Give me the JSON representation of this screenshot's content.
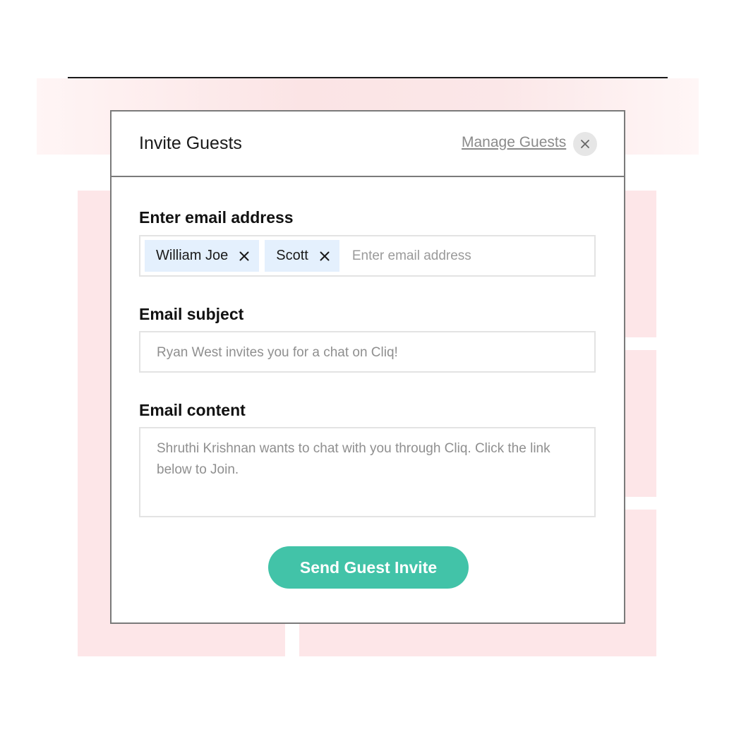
{
  "dialog": {
    "title": "Invite Guests",
    "manage_link": "Manage Guests",
    "close_icon": "close-icon"
  },
  "email_field": {
    "label": "Enter email address",
    "chips": [
      {
        "label": "William Joe",
        "remove_icon": "close-icon"
      },
      {
        "label": "Scott",
        "remove_icon": "close-icon"
      }
    ],
    "placeholder": "Enter email address"
  },
  "subject_field": {
    "label": "Email subject",
    "value": "Ryan West invites you for a chat on Cliq!"
  },
  "content_field": {
    "label": "Email content",
    "value": "Shruthi Krishnan wants to chat with you through Cliq. Click the link below to Join."
  },
  "send_button": {
    "label": "Send Guest Invite",
    "color": "#42c3a8"
  },
  "colors": {
    "chip_background": "#e4f0fd",
    "background_blocks": "#fde6e8"
  }
}
